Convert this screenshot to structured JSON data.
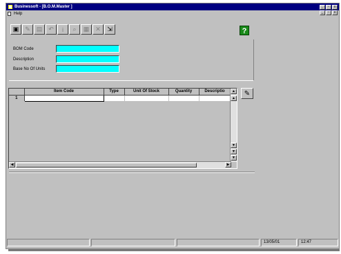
{
  "window": {
    "title": "Businessoft - [B.O.M.Master ]",
    "min_label": "_",
    "max_label": "▫",
    "close_label": "x"
  },
  "menu": {
    "items": [
      "Help"
    ]
  },
  "toolbar": {
    "buttons": [
      {
        "icon": "new-record-icon",
        "glyph": "▣",
        "enabled": true
      },
      {
        "icon": "edit-icon",
        "glyph": "✎",
        "enabled": false
      },
      {
        "icon": "save-icon",
        "glyph": "▤",
        "enabled": false
      },
      {
        "icon": "undo-icon",
        "glyph": "↶",
        "enabled": false
      },
      {
        "icon": "info-icon",
        "glyph": "i",
        "enabled": false
      },
      {
        "icon": "search-icon",
        "glyph": "⌕",
        "enabled": false
      },
      {
        "icon": "print-icon",
        "glyph": "▦",
        "enabled": false
      },
      {
        "icon": "delete-icon",
        "glyph": "✕",
        "enabled": false
      },
      {
        "icon": "exit-icon",
        "glyph": "⇲",
        "enabled": true
      }
    ],
    "help_label": "?"
  },
  "form": {
    "fields": [
      {
        "label": "BOM Code",
        "value": ""
      },
      {
        "label": "Description",
        "value": ""
      },
      {
        "label": "Base No Of Units",
        "value": ""
      }
    ]
  },
  "grid": {
    "columns": [
      "",
      "Item Code",
      "Type",
      "Unit Of Stock",
      "Quantity",
      "Descriptio"
    ],
    "rows": [
      [
        "1",
        "",
        "",
        "",
        "",
        ""
      ]
    ],
    "side_icon": "pencil-icon"
  },
  "status": {
    "panels": [
      "",
      "",
      "",
      "13/05/01",
      "12:47"
    ]
  },
  "colors": {
    "titlebar": "#000080",
    "input_bg": "#00ffff",
    "help_bg": "#1a8a1a"
  }
}
